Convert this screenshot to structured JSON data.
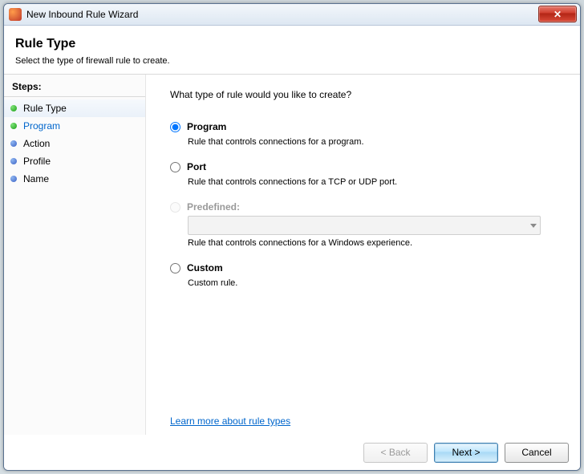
{
  "window": {
    "title": "New Inbound Rule Wizard"
  },
  "header": {
    "title": "Rule Type",
    "subtitle": "Select the type of firewall rule to create."
  },
  "sidebar": {
    "steps_label": "Steps:",
    "items": [
      {
        "label": "Rule Type",
        "bullet": "green",
        "active": true,
        "link": false
      },
      {
        "label": "Program",
        "bullet": "green",
        "active": false,
        "link": true
      },
      {
        "label": "Action",
        "bullet": "blue",
        "active": false,
        "link": false
      },
      {
        "label": "Profile",
        "bullet": "blue",
        "active": false,
        "link": false
      },
      {
        "label": "Name",
        "bullet": "blue",
        "active": false,
        "link": false
      }
    ]
  },
  "main": {
    "question": "What type of rule would you like to create?",
    "options": [
      {
        "id": "program",
        "label": "Program",
        "desc": "Rule that controls connections for a program.",
        "checked": true,
        "disabled": false
      },
      {
        "id": "port",
        "label": "Port",
        "desc": "Rule that controls connections for a TCP or UDP port.",
        "checked": false,
        "disabled": false
      },
      {
        "id": "predefined",
        "label": "Predefined:",
        "desc": "Rule that controls connections for a Windows experience.",
        "checked": false,
        "disabled": true
      },
      {
        "id": "custom",
        "label": "Custom",
        "desc": "Custom rule.",
        "checked": false,
        "disabled": false
      }
    ],
    "predefined_select": "",
    "learn_more": "Learn more about rule types"
  },
  "footer": {
    "back": "< Back",
    "next": "Next >",
    "cancel": "Cancel"
  }
}
